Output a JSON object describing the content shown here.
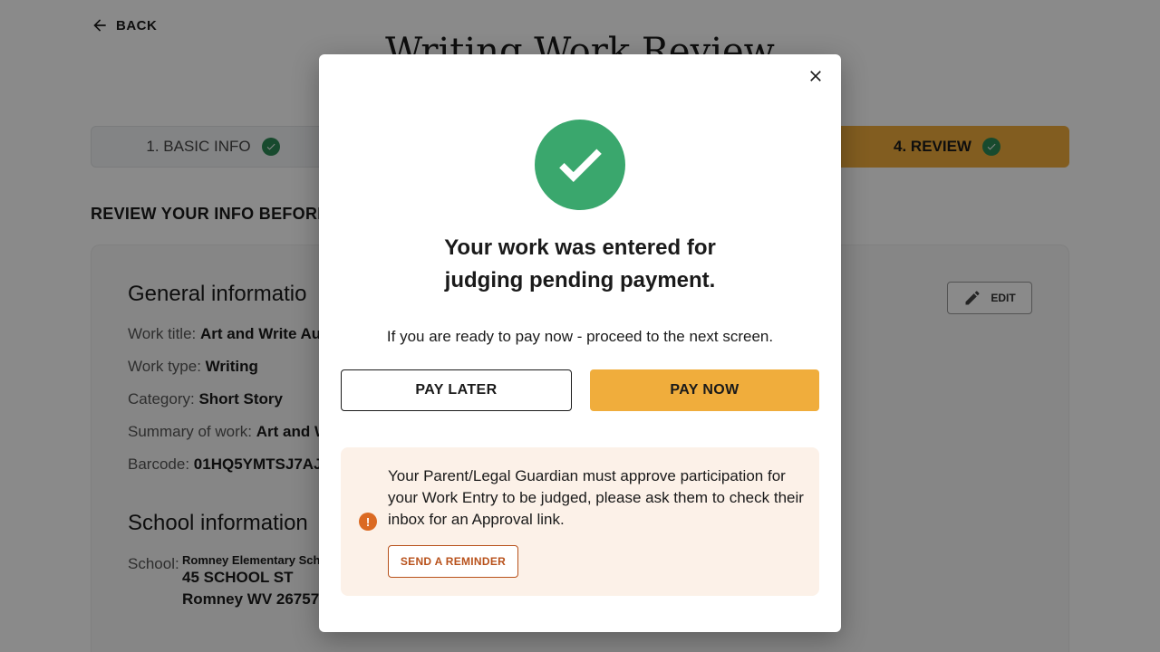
{
  "header": {
    "back_label": "BACK",
    "page_title": "Writing Work Review"
  },
  "steps": [
    {
      "label": "1. BASIC INFO",
      "complete": true
    },
    {
      "label": "4. REVIEW",
      "complete": true,
      "active": true
    }
  ],
  "review_heading": "REVIEW YOUR INFO BEFORE Y",
  "general": {
    "title": "General informatio",
    "edit_label": "EDIT",
    "rows": [
      {
        "label": "Work title:",
        "value": "Art and Write Au"
      },
      {
        "label": "Work type:",
        "value": "Writing"
      },
      {
        "label": "Category:",
        "value": "Short Story"
      },
      {
        "label": "Summary of work:",
        "value": "Art and W"
      },
      {
        "label": "Barcode:",
        "value": "01HQ5YMTSJ7AJ"
      }
    ]
  },
  "school": {
    "title": "School information",
    "label": "School:",
    "name": "Romney Elementary Sch",
    "address_line1": "45 SCHOOL ST",
    "address_line2": "Romney WV 26757"
  },
  "modal": {
    "heading_line1": "Your work was entered for",
    "heading_line2": "judging pending payment.",
    "subtext": "If you are ready to pay now - proceed to the next screen.",
    "pay_later_label": "PAY LATER",
    "pay_now_label": "PAY NOW",
    "notice_text": "Your Parent/Legal Guardian must approve participation for your Work Entry to be judged, please ask them to check their inbox for an Approval link.",
    "reminder_label": "SEND A REMINDER"
  },
  "colors": {
    "accent": "#f0ad3c",
    "success": "#3aa76d",
    "warning": "#db6a23",
    "notice_bg": "#fcf1e8"
  },
  "icons": {
    "back": "arrow-left-icon",
    "step_check": "check-circle-icon",
    "edit": "pencil-icon",
    "close": "close-icon",
    "success": "checkmark-circle-icon",
    "notice": "exclamation-circle-icon"
  }
}
